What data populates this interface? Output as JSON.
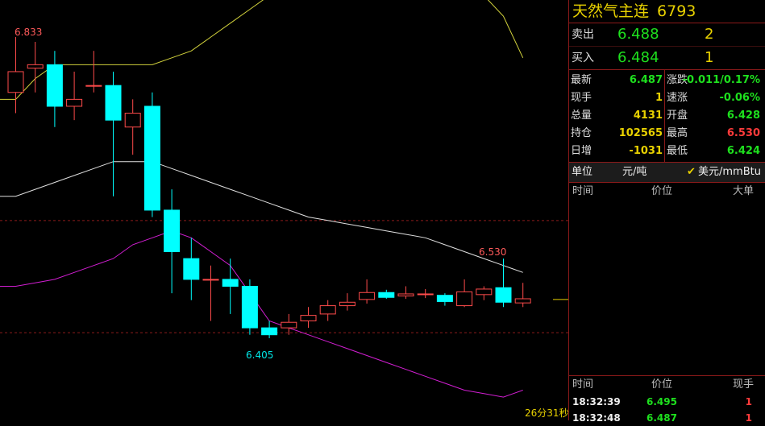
{
  "chart_data": {
    "type": "candlestick",
    "annotations": {
      "high_label": "6.833",
      "peak_label": "6.530",
      "low_label": "6.405"
    },
    "reference_lines": [
      6.575,
      6.413
    ],
    "candles": [
      {
        "o": 6.76,
        "c": 6.79,
        "h": 6.84,
        "l": 6.73
      },
      {
        "o": 6.795,
        "c": 6.8,
        "h": 6.833,
        "l": 6.76
      },
      {
        "o": 6.8,
        "c": 6.74,
        "h": 6.82,
        "l": 6.71
      },
      {
        "o": 6.74,
        "c": 6.75,
        "h": 6.79,
        "l": 6.72
      },
      {
        "o": 6.77,
        "c": 6.77,
        "h": 6.82,
        "l": 6.76
      },
      {
        "o": 6.77,
        "c": 6.72,
        "h": 6.79,
        "l": 6.61
      },
      {
        "o": 6.71,
        "c": 6.73,
        "h": 6.75,
        "l": 6.67
      },
      {
        "o": 6.74,
        "c": 6.59,
        "h": 6.76,
        "l": 6.58
      },
      {
        "o": 6.59,
        "c": 6.53,
        "h": 6.62,
        "l": 6.47
      },
      {
        "o": 6.52,
        "c": 6.49,
        "h": 6.55,
        "l": 6.46
      },
      {
        "o": 6.49,
        "c": 6.49,
        "h": 6.51,
        "l": 6.43
      },
      {
        "o": 6.49,
        "c": 6.48,
        "h": 6.52,
        "l": 6.44
      },
      {
        "o": 6.48,
        "c": 6.42,
        "h": 6.49,
        "l": 6.41
      },
      {
        "o": 6.42,
        "c": 6.41,
        "h": 6.43,
        "l": 6.405
      },
      {
        "o": 6.42,
        "c": 6.428,
        "h": 6.44,
        "l": 6.41
      },
      {
        "o": 6.43,
        "c": 6.438,
        "h": 6.45,
        "l": 6.42
      },
      {
        "o": 6.44,
        "c": 6.452,
        "h": 6.46,
        "l": 6.43
      },
      {
        "o": 6.452,
        "c": 6.457,
        "h": 6.47,
        "l": 6.445
      },
      {
        "o": 6.461,
        "c": 6.471,
        "h": 6.49,
        "l": 6.455
      },
      {
        "o": 6.471,
        "c": 6.464,
        "h": 6.475,
        "l": 6.462
      },
      {
        "o": 6.466,
        "c": 6.469,
        "h": 6.48,
        "l": 6.462
      },
      {
        "o": 6.469,
        "c": 6.469,
        "h": 6.476,
        "l": 6.463
      },
      {
        "o": 6.467,
        "c": 6.458,
        "h": 6.47,
        "l": 6.452
      },
      {
        "o": 6.452,
        "c": 6.472,
        "h": 6.49,
        "l": 6.45
      },
      {
        "o": 6.468,
        "c": 6.476,
        "h": 6.48,
        "l": 6.46
      },
      {
        "o": 6.478,
        "c": 6.457,
        "h": 6.52,
        "l": 6.45
      },
      {
        "o": 6.456,
        "c": 6.462,
        "h": 6.485,
        "l": 6.45
      }
    ],
    "ma_upper": [
      6.75,
      6.78,
      6.8,
      6.8,
      6.8,
      6.8,
      6.8,
      6.8,
      6.81,
      6.82,
      6.84,
      6.86,
      6.88,
      6.9,
      6.92,
      6.93,
      6.93,
      6.93,
      6.93,
      6.93,
      6.93,
      6.93,
      6.93,
      6.92,
      6.9,
      6.87,
      6.81
    ],
    "ma_mid": [
      6.61,
      6.62,
      6.63,
      6.64,
      6.65,
      6.66,
      6.66,
      6.66,
      6.65,
      6.64,
      6.63,
      6.62,
      6.61,
      6.6,
      6.59,
      6.58,
      6.575,
      6.57,
      6.565,
      6.56,
      6.555,
      6.55,
      6.54,
      6.53,
      6.52,
      6.51,
      6.5
    ],
    "ma_lower": [
      6.48,
      6.485,
      6.49,
      6.5,
      6.51,
      6.52,
      6.54,
      6.55,
      6.56,
      6.55,
      6.53,
      6.51,
      6.47,
      6.43,
      6.42,
      6.41,
      6.4,
      6.39,
      6.38,
      6.37,
      6.36,
      6.35,
      6.34,
      6.33,
      6.325,
      6.32,
      6.33
    ],
    "last_price_marker": 6.461
  },
  "panel": {
    "title": "天然气主连",
    "code": "6793",
    "ask": {
      "label": "卖出",
      "price": "6.488",
      "vol": "2"
    },
    "bid": {
      "label": "买入",
      "price": "6.484",
      "vol": "1"
    },
    "stats": [
      {
        "l1": "最新",
        "v1": "6.487",
        "c1": "green",
        "l2": "涨跌",
        "v2": "-0.011/0.17%",
        "c2": "green"
      },
      {
        "l1": "现手",
        "v1": "1",
        "c1": "yellow",
        "l2": "速涨",
        "v2": "-0.06%",
        "c2": "green"
      },
      {
        "l1": "总量",
        "v1": "4131",
        "c1": "yellow",
        "l2": "开盘",
        "v2": "6.428",
        "c2": "green"
      },
      {
        "l1": "持仓",
        "v1": "102565",
        "c1": "yellow",
        "l2": "最高",
        "v2": "6.530",
        "c2": "red"
      },
      {
        "l1": "日增",
        "v1": "-1031",
        "c1": "yellow",
        "l2": "最低",
        "v2": "6.424",
        "c2": "green"
      }
    ],
    "unit_label": "单位",
    "unit_left": "元/吨",
    "unit_check": "✔",
    "unit_right": "美元/mmBtu",
    "big_header": {
      "time": "时间",
      "price": "价位",
      "size": "大单"
    },
    "tick_header": {
      "time": "时间",
      "price": "价位",
      "size": "现手"
    },
    "ticks": [
      {
        "time": "18:32:39",
        "price": "6.495",
        "size": "1"
      },
      {
        "time": "18:32:48",
        "price": "6.487",
        "size": "1"
      }
    ],
    "timer": "26分31秒"
  },
  "colors": {
    "up": "#ff4b4b",
    "down": "#00ffff",
    "ma_upper": "#d2d23c",
    "ma_mid": "#e0e0e0",
    "ma_lower": "#d21ed2",
    "grid": "#8b1a1a"
  }
}
